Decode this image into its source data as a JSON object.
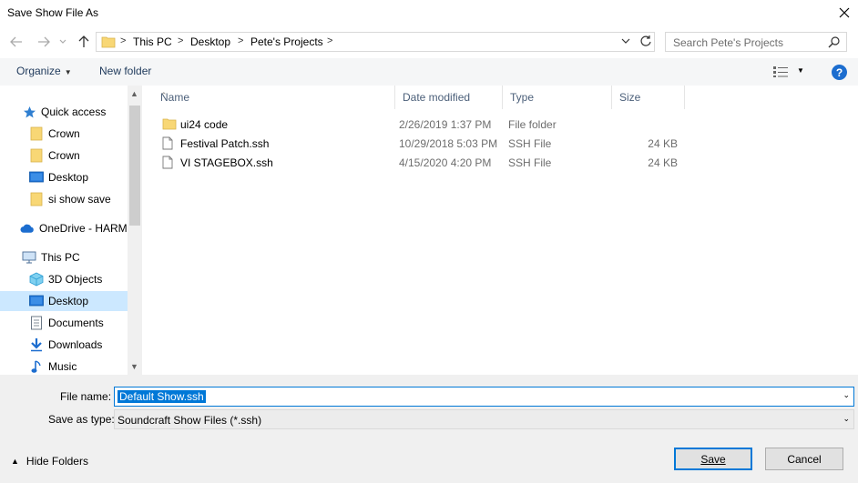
{
  "window": {
    "title": "Save Show File As"
  },
  "address": {
    "crumbs": [
      "This PC",
      "Desktop",
      "Pete's Projects"
    ]
  },
  "search": {
    "placeholder": "Search Pete's Projects"
  },
  "commands": {
    "organize": "Organize",
    "new_folder": "New folder",
    "help": "?"
  },
  "nav": {
    "items": [
      {
        "label": "Quick access",
        "icon": "star-icon"
      },
      {
        "label": "Crown",
        "icon": "folder-icon"
      },
      {
        "label": "Crown",
        "icon": "folder-icon"
      },
      {
        "label": "Desktop",
        "icon": "desktop-icon"
      },
      {
        "label": "si show save",
        "icon": "folder-icon"
      },
      {
        "label": "OneDrive - HARM",
        "icon": "cloud-icon"
      },
      {
        "label": "This PC",
        "icon": "computer-icon"
      },
      {
        "label": "3D Objects",
        "icon": "cube-icon"
      },
      {
        "label": "Desktop",
        "icon": "desktop-icon",
        "selected": true
      },
      {
        "label": "Documents",
        "icon": "document-icon"
      },
      {
        "label": "Downloads",
        "icon": "download-icon"
      },
      {
        "label": "Music",
        "icon": "music-icon"
      }
    ]
  },
  "columns": {
    "name": "Name",
    "date": "Date modified",
    "type": "Type",
    "size": "Size"
  },
  "files": [
    {
      "name": "ui24 code",
      "date": "2/26/2019 1:37 PM",
      "type": "File folder",
      "size": "",
      "icon": "folder-icon"
    },
    {
      "name": "Festival Patch.ssh",
      "date": "10/29/2018 5:03 PM",
      "type": "SSH File",
      "size": "24 KB",
      "icon": "file-icon"
    },
    {
      "name": "VI STAGEBOX.ssh",
      "date": "4/15/2020 4:20 PM",
      "type": "SSH File",
      "size": "24 KB",
      "icon": "file-icon"
    }
  ],
  "form": {
    "file_name_label": "File name:",
    "file_name_value": "Default Show.ssh",
    "save_type_label": "Save as type:",
    "save_type_value": "Soundcraft Show Files (*.ssh)"
  },
  "footer": {
    "hide_folders": "Hide Folders",
    "save": "Save",
    "cancel": "Cancel"
  },
  "colors": {
    "accent": "#0078d7",
    "selection": "#cce8ff",
    "folder": "#f8d775"
  }
}
